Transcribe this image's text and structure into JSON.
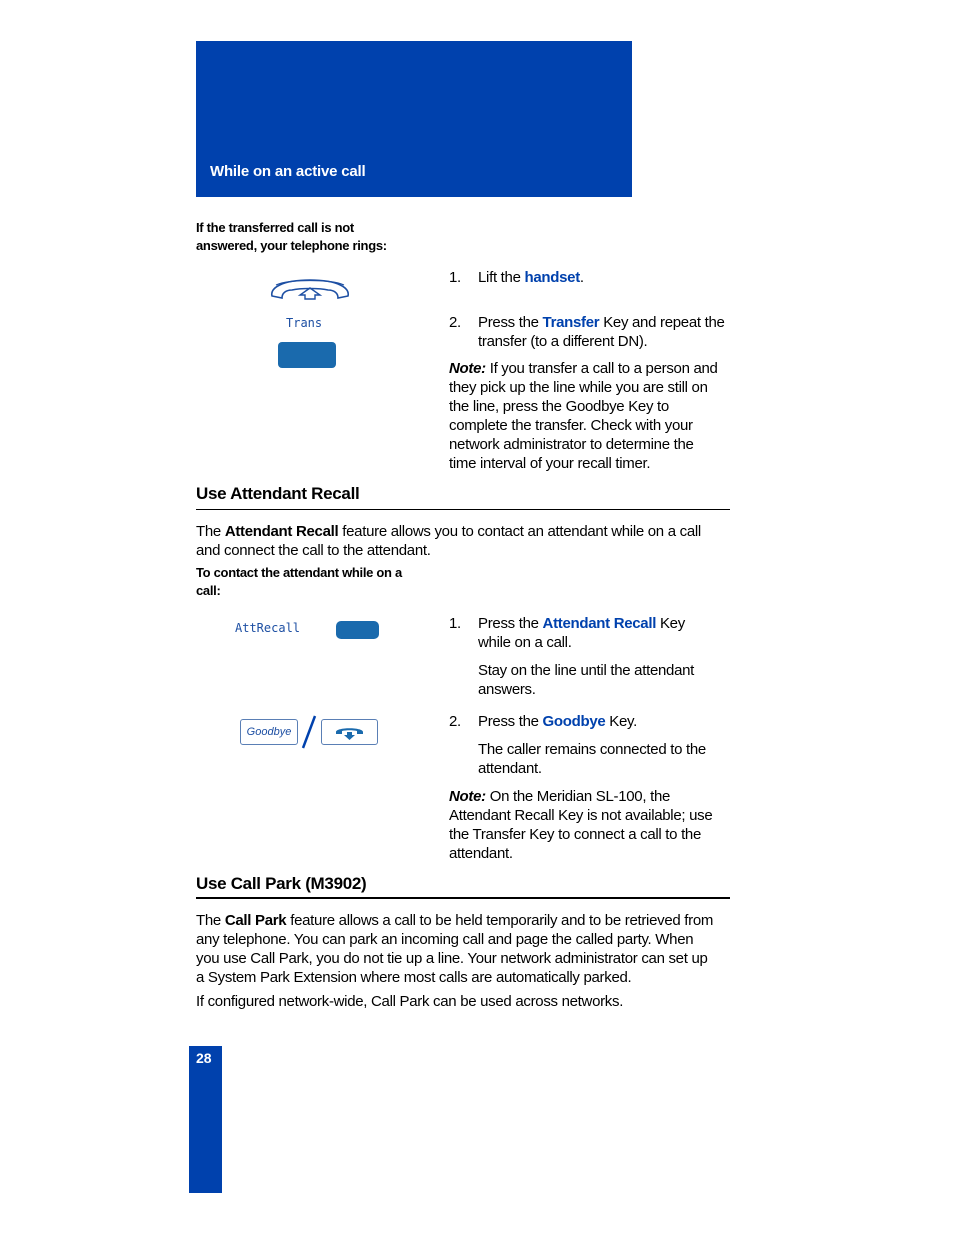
{
  "header": {
    "section_title": "While on an active call"
  },
  "transfer_block": {
    "lead": "If the transferred call is not answered, your telephone rings:",
    "lead_line1": "If the transferred call is not",
    "lead_line2": "answered, your telephone rings:",
    "softkey_label": "Trans",
    "steps": [
      {
        "num": "1.",
        "pre": "Lift the ",
        "keyword": "handset",
        "post": "."
      },
      {
        "num": "2.",
        "pre": "Press the ",
        "keyword": "Transfer",
        "post": " Key and repeat the",
        "line2": "transfer (to a different DN)."
      }
    ],
    "note": {
      "label": "Note:",
      "lines": [
        " If you transfer a call to a person and",
        "they pick up the line while you are still on",
        "the line, press the Goodbye Key to",
        "complete the transfer. Check with your",
        "network administrator to determine the",
        "time interval of your recall timer."
      ]
    }
  },
  "attendant_recall": {
    "heading": "Use Attendant Recall",
    "intro_pre": "The ",
    "intro_bold": "Attendant Recall",
    "intro_line1_post": " feature allows you to contact an attendant while on a call",
    "intro_line2": "and connect the call to the attendant.",
    "lead_line1": "To contact the attendant while on a",
    "lead_line2": "call:",
    "softkey_label": "AttRecall",
    "goodbye_key_label": "Goodbye",
    "steps": [
      {
        "num": "1.",
        "pre": "Press the ",
        "keyword": "Attendant Recall",
        "post": " Key",
        "line2": "while on a call.",
        "sub_line1": "Stay on the line until the attendant",
        "sub_line2": "answers."
      },
      {
        "num": "2.",
        "pre": "Press the ",
        "keyword": "Goodbye",
        "post": " Key.",
        "sub_line1": "The caller remains connected to the",
        "sub_line2": "attendant."
      }
    ],
    "note": {
      "label": "Note:",
      "lines": [
        " On the Meridian SL-100, the",
        "Attendant Recall Key is not available; use",
        "the Transfer Key to connect a call to the",
        "attendant."
      ]
    }
  },
  "call_park": {
    "heading": "Use Call Park (M3902)",
    "para1_pre": "The ",
    "para1_bold": "Call Park",
    "para1_line1_post": " feature allows a call to be held temporarily and to be retrieved from",
    "para1_line2": "any telephone. You can park an incoming call and page the called party. When",
    "para1_line3": "you use Call Park, you do not tie up a line. Your network administrator can set up",
    "para1_line4": "a System Park Extension where most calls are automatically parked.",
    "para2": "If configured network-wide, Call Park can be used across networks."
  },
  "footer": {
    "page_number": "28"
  },
  "colors": {
    "brand_blue": "#0041ad",
    "softkey_blue": "#1a6aad"
  }
}
